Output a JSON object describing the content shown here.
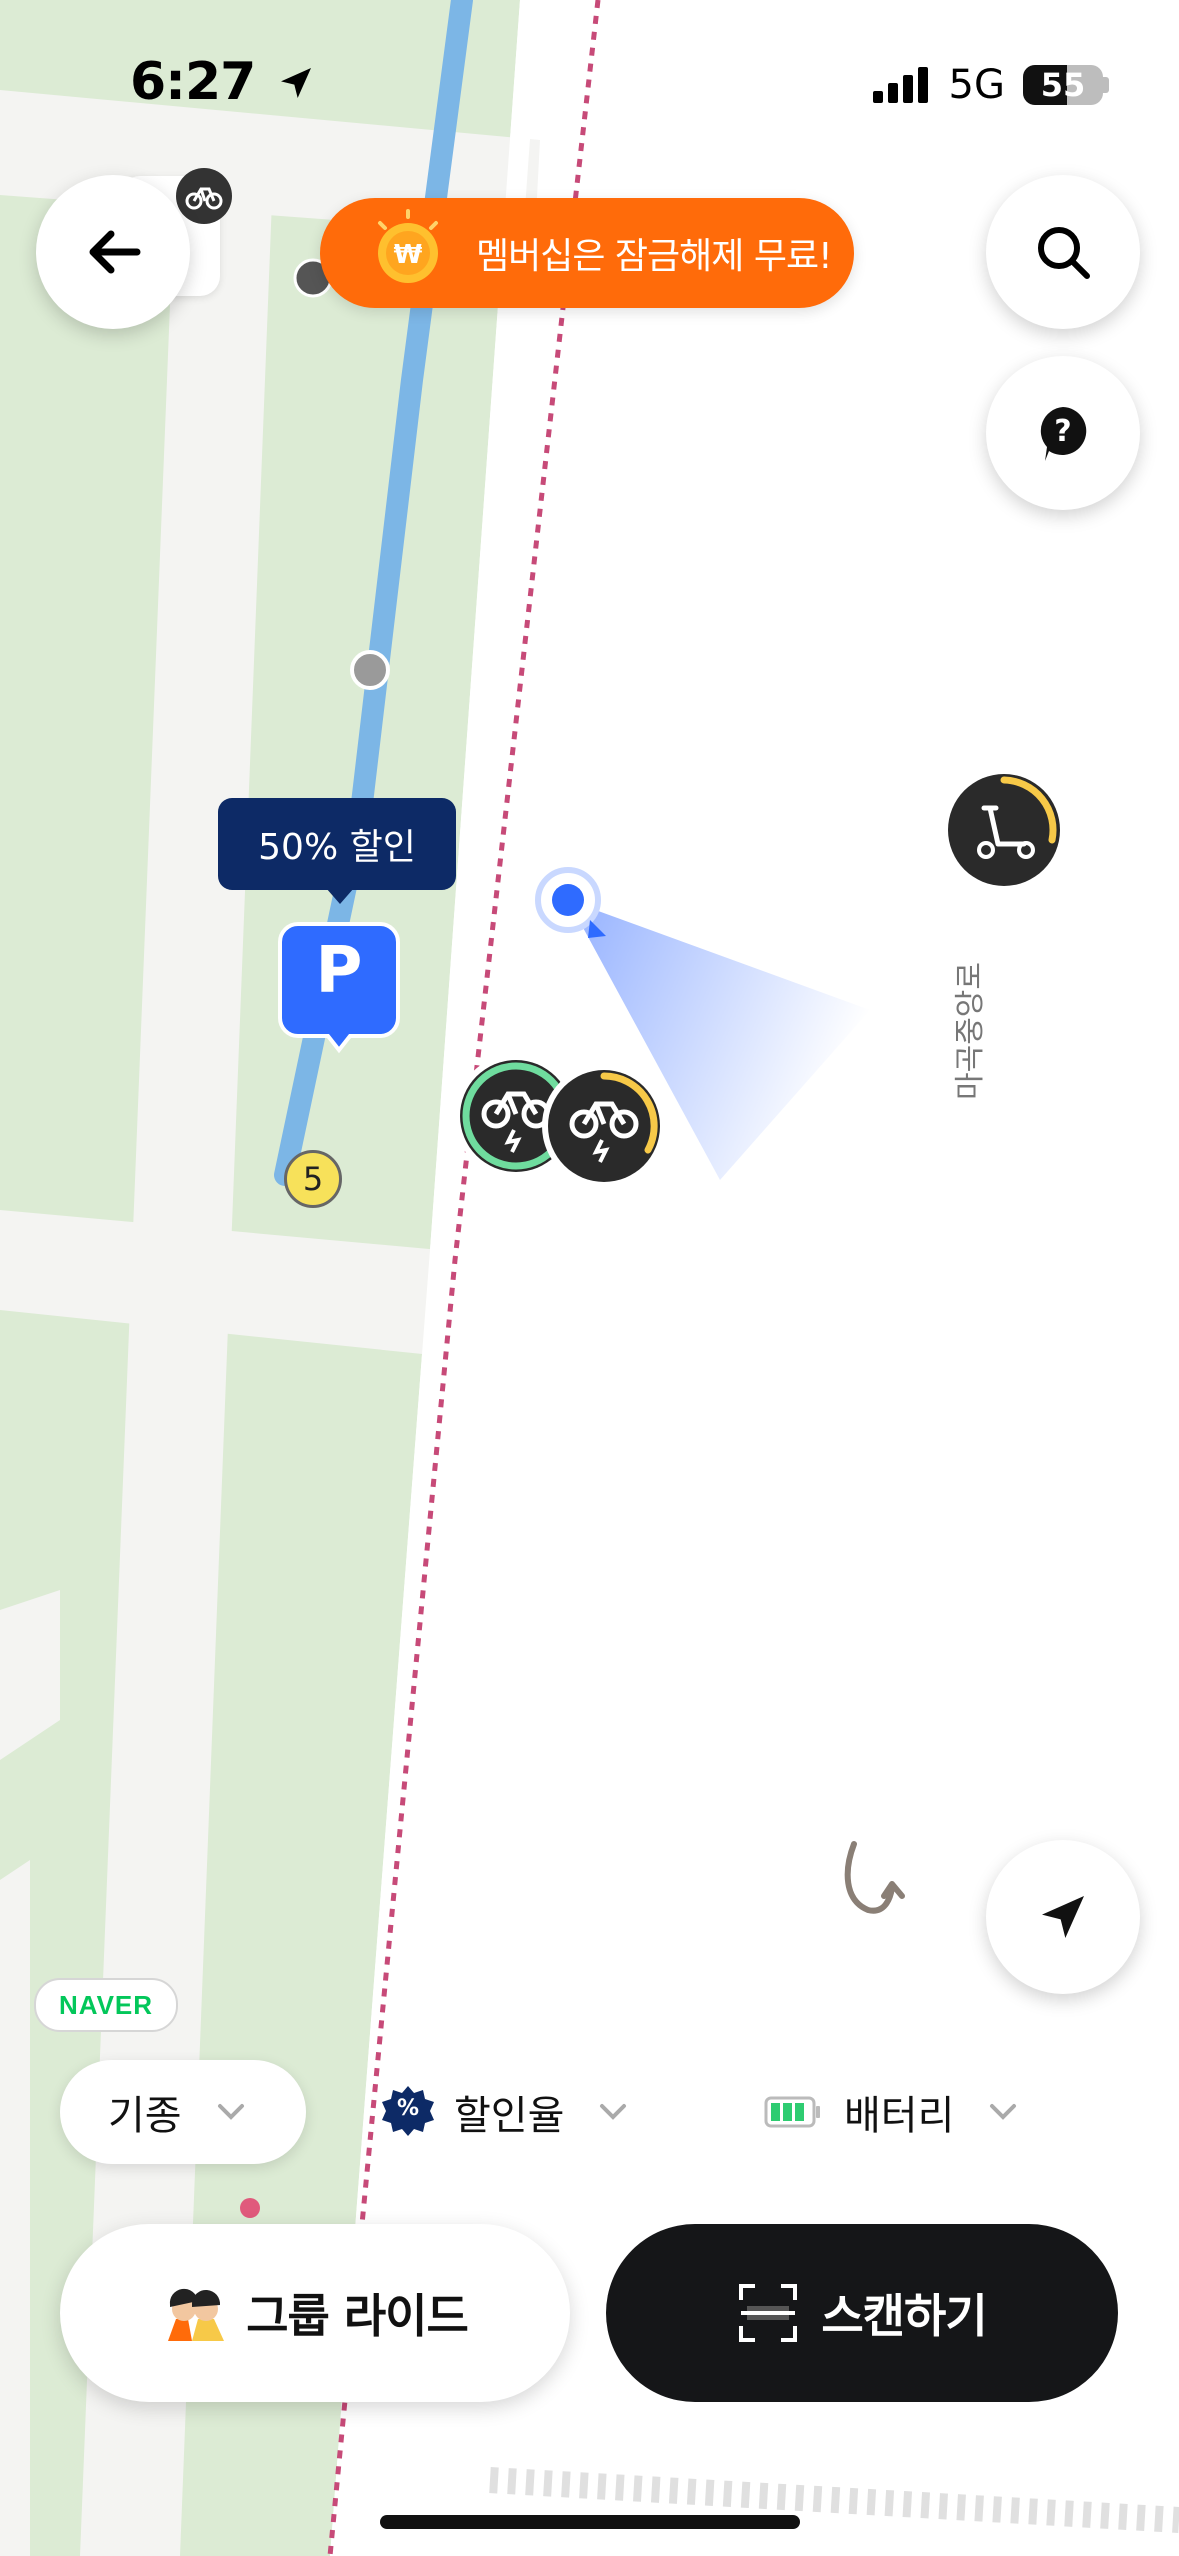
{
  "status_bar": {
    "time": "6:27",
    "network": "5G",
    "battery": "55",
    "battery_level": 0.55
  },
  "promo": {
    "text": "멤버십은 잠금해제 무료!"
  },
  "map": {
    "parking_discount_label": "50% 할인",
    "parking_icon_label": "P",
    "station_number": "5",
    "road_label": "마곡중앙로",
    "provider_badge": "NAVER"
  },
  "filters": {
    "model_label": "기종",
    "discount_label": "할인율",
    "discount_icon_symbol": "%",
    "battery_label": "배터리"
  },
  "actions": {
    "group_ride_label": "그룹 라이드",
    "scan_label": "스캔하기"
  },
  "colors": {
    "promo_orange": "#ff6b0a",
    "navy": "#0d2a66",
    "parking_blue": "#2f6bff",
    "park_green": "#dcebd4",
    "path_blue": "#7cb6e6",
    "boundary_pink": "#c74a78",
    "battery_yellow": "#f7c948",
    "battery_green": "#6fdc9e",
    "scan_dark": "#151618"
  },
  "icons": [
    "back-arrow-icon",
    "search-icon",
    "help-icon",
    "location-arrow-icon",
    "bicycle-icon",
    "scooter-icon",
    "coin-icon",
    "chevron-down-icon",
    "scan-icon",
    "group-ride-icon",
    "discount-badge-icon",
    "battery-icon",
    "u-turn-icon"
  ]
}
